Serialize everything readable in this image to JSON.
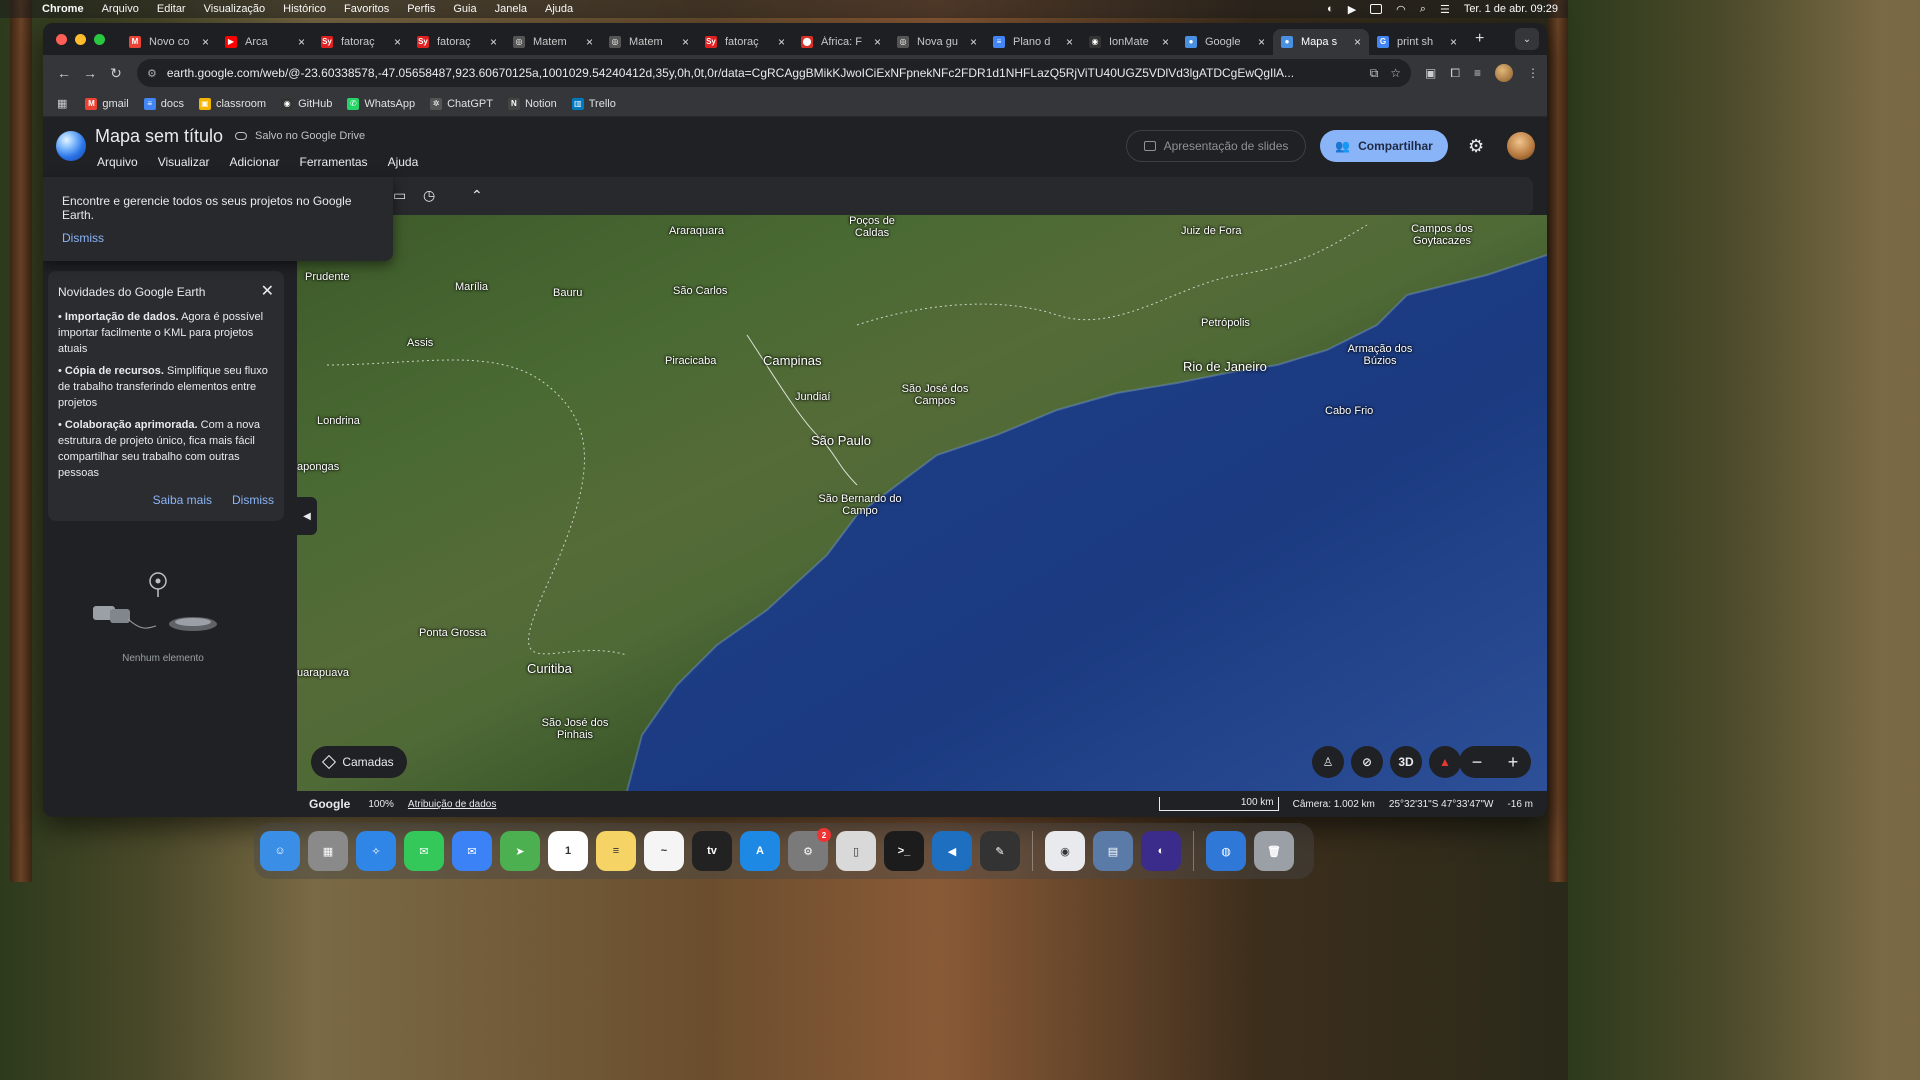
{
  "menubar": {
    "app": "Chrome",
    "items": [
      "Arquivo",
      "Editar",
      "Visualização",
      "Histórico",
      "Favoritos",
      "Perfis",
      "Guia",
      "Janela",
      "Ajuda"
    ],
    "clock": "Ter. 1 de abr.  09:29"
  },
  "tabs": [
    {
      "title": "Novo co",
      "favicon_color": "#ea4335",
      "glyph": "M"
    },
    {
      "title": "Arca",
      "favicon_color": "#ff0000",
      "glyph": "▶"
    },
    {
      "title": "fatoraç",
      "favicon_color": "#e02020",
      "glyph": "Sy"
    },
    {
      "title": "fatoraç",
      "favicon_color": "#e02020",
      "glyph": "Sy"
    },
    {
      "title": "Matem",
      "favicon_color": "#555555",
      "glyph": "◎"
    },
    {
      "title": "Matem",
      "favicon_color": "#555555",
      "glyph": "◎"
    },
    {
      "title": "fatoraç",
      "favicon_color": "#e02020",
      "glyph": "Sy"
    },
    {
      "title": "África: F",
      "favicon_color": "#d93025",
      "glyph": "⬤"
    },
    {
      "title": "Nova gu",
      "favicon_color": "#555555",
      "glyph": "◎"
    },
    {
      "title": "Plano d",
      "favicon_color": "#4285f4",
      "glyph": "≡"
    },
    {
      "title": "IonMate",
      "favicon_color": "#333333",
      "glyph": "◉"
    },
    {
      "title": "Google",
      "favicon_color": "#4a90e2",
      "glyph": "●"
    },
    {
      "title": "Mapa s",
      "favicon_color": "#4a90e2",
      "glyph": "●",
      "active": true
    },
    {
      "title": "print sh",
      "favicon_color": "#4285f4",
      "glyph": "G"
    }
  ],
  "omnibox": {
    "url": "earth.google.com/web/@-23.60338578,-47.05658487,923.60670125a,1001029.54240412d,35y,0h,0t,0r/data=CgRCAggBMikKJwoICiExNFpnekNFc2FDR1d1NHFLazQ5RjViTU40UGZ5VDlVd3lgATDCgEwQgIlA..."
  },
  "bookmarks": [
    {
      "label": "gmail",
      "color": "#ea4335",
      "glyph": "M"
    },
    {
      "label": "docs",
      "color": "#4285f4",
      "glyph": "≡"
    },
    {
      "label": "classroom",
      "color": "#f4b400",
      "glyph": "▣"
    },
    {
      "label": "GitHub",
      "color": "#333333",
      "glyph": "◉"
    },
    {
      "label": "WhatsApp",
      "color": "#25d366",
      "glyph": "✆"
    },
    {
      "label": "ChatGPT",
      "color": "#555555",
      "glyph": "✲"
    },
    {
      "label": "Notion",
      "color": "#444444",
      "glyph": "N"
    },
    {
      "label": "Trello",
      "color": "#0079bf",
      "glyph": "▥"
    }
  ],
  "app": {
    "title": "Mapa sem título",
    "saved": "Salvo no Google Drive",
    "menu": [
      "Arquivo",
      "Visualizar",
      "Adicionar",
      "Ferramentas",
      "Ajuda"
    ],
    "slides_label": "Apresentação de slides",
    "share_label": "Compartilhar"
  },
  "tip": {
    "text": "Encontre e gerencie todos os seus projetos no Google Earth.",
    "dismiss": "Dismiss"
  },
  "news": {
    "title": "Novidades do Google Earth",
    "items": [
      {
        "bold": "Importação de dados.",
        "text": " Agora é possível importar facilmente o KML para projetos atuais"
      },
      {
        "bold": "Cópia de recursos.",
        "text": " Simplifique seu fluxo de trabalho transferindo elementos entre projetos"
      },
      {
        "bold": "Colaboração aprimorada.",
        "text": " Com a nova estrutura de projeto único, fica mais fácil compartilhar seu trabalho com outras pessoas"
      }
    ],
    "learn_more": "Saiba mais",
    "dismiss": "Dismiss"
  },
  "empty_text": "Nenhum elemento",
  "map": {
    "layers_label": "Camadas",
    "cities": [
      {
        "name": "Araraquara",
        "big": false
      },
      {
        "name": "Poços de Caldas",
        "big": false
      },
      {
        "name": "Juiz de Fora",
        "big": false
      },
      {
        "name": "Campos dos Goytacazes",
        "big": false
      },
      {
        "name": "Prudente",
        "big": false
      },
      {
        "name": "Marília",
        "big": false
      },
      {
        "name": "Bauru",
        "big": false
      },
      {
        "name": "São Carlos",
        "big": false
      },
      {
        "name": "Petrópolis",
        "big": false
      },
      {
        "name": "Assis",
        "big": false
      },
      {
        "name": "Piracicaba",
        "big": false
      },
      {
        "name": "Campinas",
        "big": true
      },
      {
        "name": "São José dos Campos",
        "big": false
      },
      {
        "name": "Rio de Janeiro",
        "big": true
      },
      {
        "name": "Armação dos Búzios",
        "big": false
      },
      {
        "name": "Jundiaí",
        "big": false
      },
      {
        "name": "Cabo Frio",
        "big": false
      },
      {
        "name": "Londrina",
        "big": false
      },
      {
        "name": "São Paulo",
        "big": true
      },
      {
        "name": "apongas",
        "big": false
      },
      {
        "name": "São Bernardo do Campo",
        "big": false
      },
      {
        "name": "Ponta Grossa",
        "big": false
      },
      {
        "name": "Curitiba",
        "big": true
      },
      {
        "name": "uarapuava",
        "big": false
      },
      {
        "name": "São José dos Pinhais",
        "big": false
      }
    ],
    "ctrl_3d": "3D"
  },
  "status": {
    "brand": "Google",
    "zoom": "100%",
    "attribution": "Atribuição de dados",
    "scale": "100 km",
    "camera": "Câmera: 1.002 km",
    "coords": "25°32'31\"S 47°33'47\"W",
    "elevation": "-16 m"
  },
  "dock": [
    {
      "name": "finder",
      "color": "#3a8ee6",
      "glyph": "☺"
    },
    {
      "name": "launchpad",
      "color": "#8a8a8a",
      "glyph": "▦"
    },
    {
      "name": "safari",
      "color": "#2f86e6",
      "glyph": "✧"
    },
    {
      "name": "messages",
      "color": "#34c759",
      "glyph": "✉"
    },
    {
      "name": "mail",
      "color": "#3b82f6",
      "glyph": "✉"
    },
    {
      "name": "maps",
      "color": "#4caf50",
      "glyph": "➤"
    },
    {
      "name": "calendar",
      "color": "#ffffff",
      "glyph": "1"
    },
    {
      "name": "notes",
      "color": "#f6d365",
      "glyph": "≡"
    },
    {
      "name": "freeform",
      "color": "#f5f5f5",
      "glyph": "~"
    },
    {
      "name": "apple-tv",
      "color": "#222222",
      "glyph": "tv"
    },
    {
      "name": "app-store",
      "color": "#1e88e5",
      "glyph": "A"
    },
    {
      "name": "system-settings",
      "color": "#7a7a7a",
      "glyph": "⚙",
      "badge": "2"
    },
    {
      "name": "ipad-mirror",
      "color": "#d9d9d9",
      "glyph": "▯"
    },
    {
      "name": "terminal",
      "color": "#1c1c1c",
      "glyph": ">_"
    },
    {
      "name": "vscode",
      "color": "#1e6fbf",
      "glyph": "◀"
    },
    {
      "name": "pages",
      "color": "#333333",
      "glyph": "✎"
    },
    {
      "name": "chrome",
      "color": "#e8eaed",
      "glyph": "◉"
    },
    {
      "name": "preview",
      "color": "#5a7ba8",
      "glyph": "▤"
    },
    {
      "name": "arc",
      "color": "#3b2c8c",
      "glyph": "◐"
    },
    {
      "name": "downloads",
      "color": "#2f78d8",
      "glyph": "◍"
    },
    {
      "name": "trash",
      "color": "#9aa0a6",
      "glyph": "🗑"
    }
  ]
}
